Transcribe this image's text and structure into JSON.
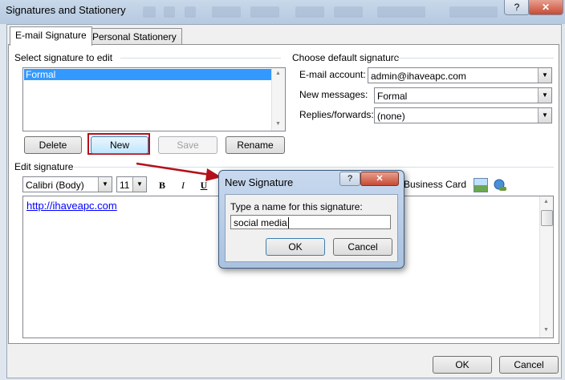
{
  "window": {
    "title": "Signatures and Stationery",
    "help_label": "?",
    "close_label": "✕"
  },
  "tabs": [
    "E-mail Signature",
    "Personal Stationery"
  ],
  "select_section": {
    "heading": "Select signature to edit",
    "items": [
      "Formal"
    ]
  },
  "signature_buttons": {
    "delete": "Delete",
    "new": "New",
    "save": "Save",
    "rename": "Rename"
  },
  "defaults": {
    "heading": "Choose default signature",
    "account_label": "E-mail account:",
    "account_value": "admin@ihaveapc.com",
    "new_messages_label": "New messages:",
    "new_messages_value": "Formal",
    "replies_label": "Replies/forwards:",
    "replies_value": "(none)"
  },
  "edit_section": {
    "heading": "Edit signature",
    "font": "Calibri (Body)",
    "size": "11",
    "bold": "B",
    "italic": "I",
    "underline": "U",
    "business_card": "Business Card",
    "content": "http://ihaveapc.com"
  },
  "footer": {
    "ok": "OK",
    "cancel": "Cancel"
  },
  "dialog": {
    "title": "New Signature",
    "help": "?",
    "close": "✕",
    "prompt": "Type a name for this signature:",
    "value": "social media",
    "ok": "OK",
    "cancel": "Cancel"
  },
  "colors": {
    "selection": "#3399ff",
    "link": "#0000ff",
    "annotation": "#b4101a",
    "dialog_close": "#c74a34"
  }
}
